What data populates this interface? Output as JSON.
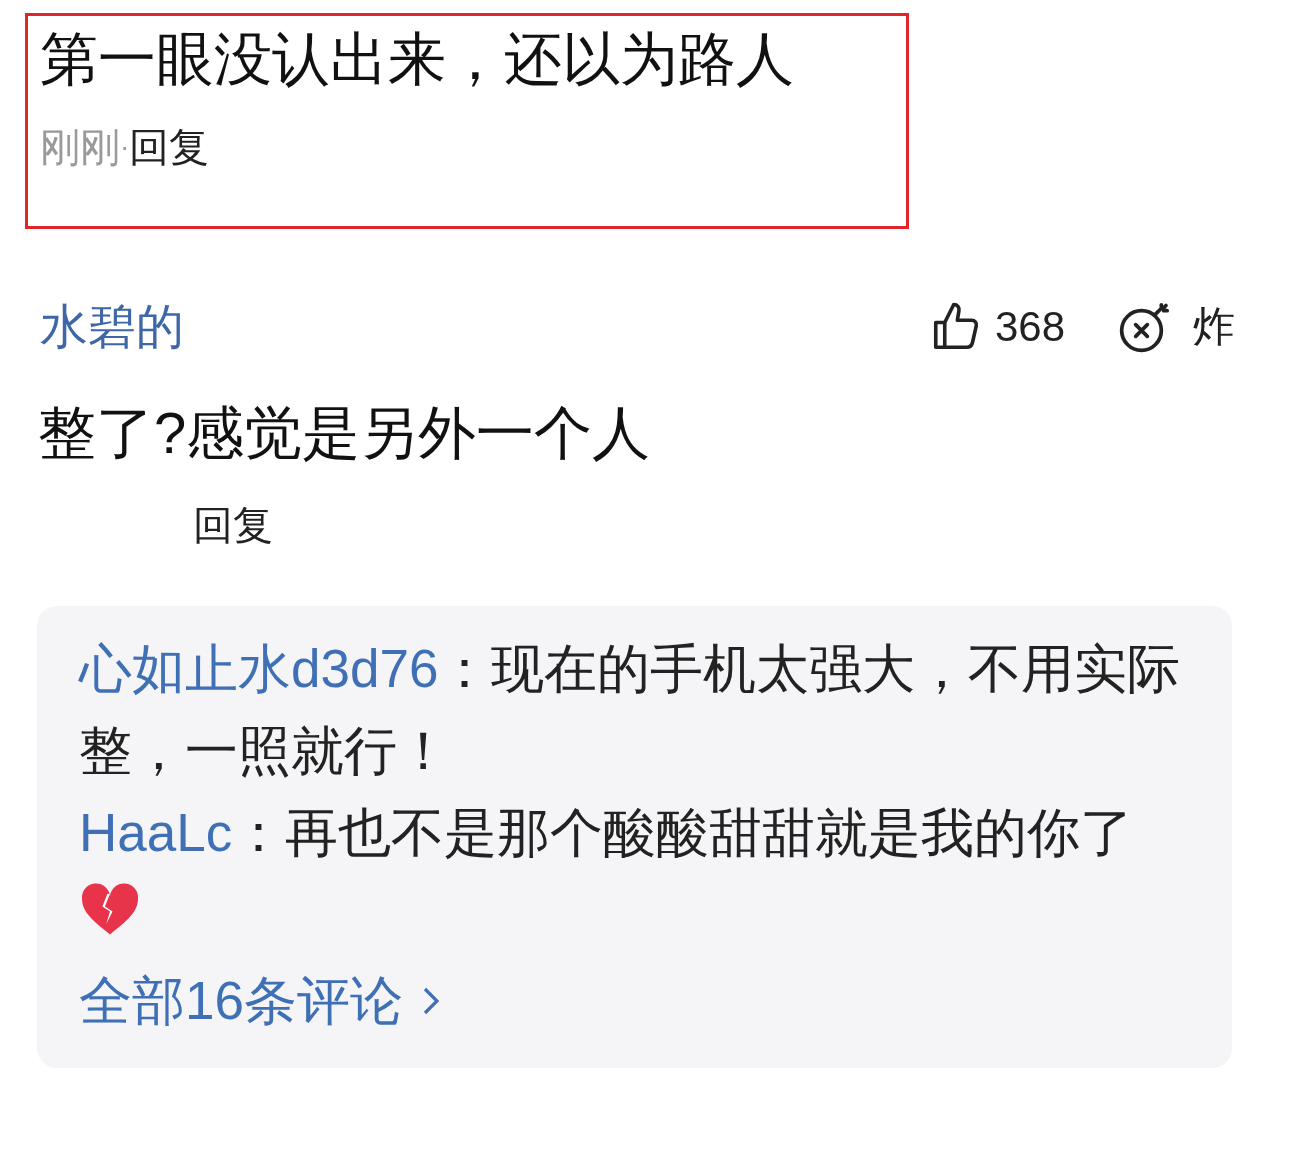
{
  "top_comment": {
    "text": "第一眼没认出来，还以为路人",
    "time": "刚刚",
    "separator": "·",
    "reply": "回复",
    "highlighted": true
  },
  "comment": {
    "username": "水碧的",
    "likes": "368",
    "bomb_label": "炸",
    "text": "整了?感觉是另外一个人",
    "reply": "回复",
    "replies": [
      {
        "username": "心如止水d3d76",
        "separator": "：",
        "text": "现在的手机太强大，不用实际整，一照就行！"
      },
      {
        "username": "HaaLc",
        "separator": "：",
        "text": "再也不是那个酸酸甜甜就是我的你了",
        "broken_heart": true
      }
    ],
    "view_all": "全部16条评论"
  }
}
